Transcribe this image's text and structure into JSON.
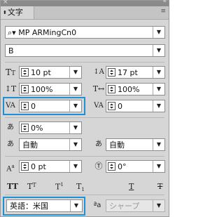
{
  "panel": {
    "tab_label": "文字",
    "font_family": "MP ARMingCn0",
    "font_style": "B",
    "font_size": "10 pt",
    "leading": "17 pt",
    "vertical_scale": "100%",
    "horizontal_scale": "100%",
    "kerning": "0",
    "tracking": "0",
    "tsume": "0%",
    "aki_left": "自動",
    "aki_right": "自動",
    "baseline_shift": "0 pt",
    "rotation": "0°",
    "language": "英語：米国",
    "sharp": "シャープ",
    "aa_label": "ªa"
  },
  "colors": {
    "highlight": "#1e90d6",
    "panel_bg": "#d6d6d6"
  }
}
